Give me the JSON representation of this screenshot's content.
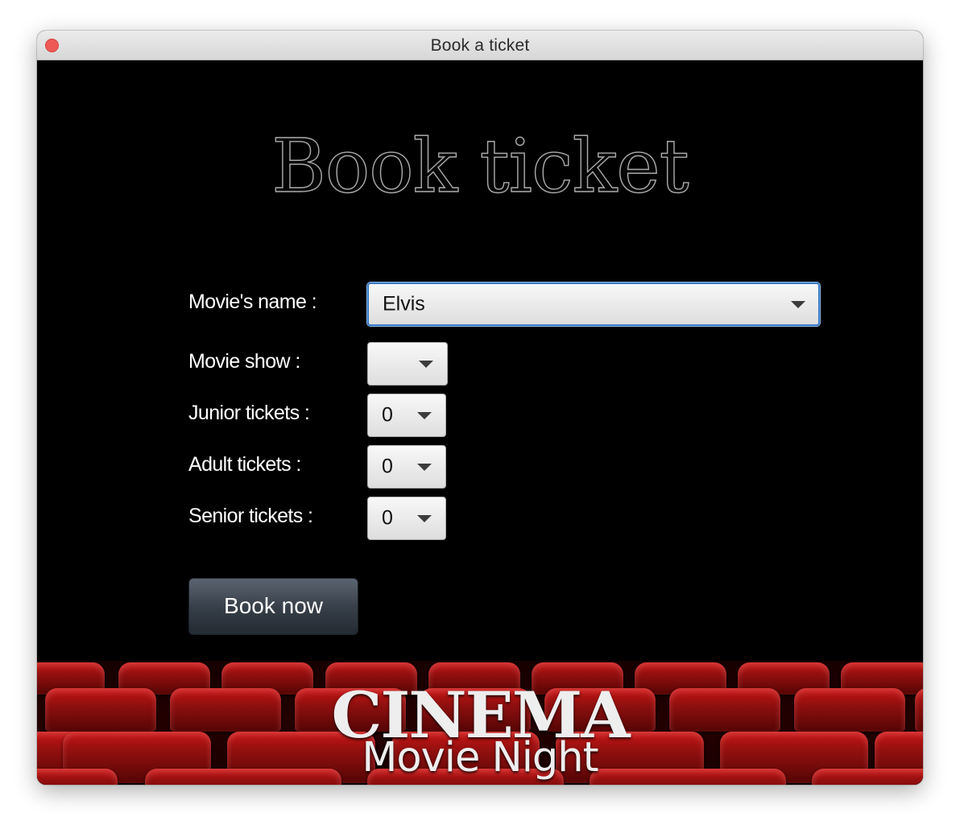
{
  "window": {
    "title": "Book a ticket"
  },
  "heading": "Book ticket",
  "form": {
    "movie_label": "Movie's name :",
    "movie_value": "Elvis",
    "show_label": "Movie show :",
    "show_value": "",
    "junior_label": "Junior tickets :",
    "junior_value": "0",
    "adult_label": "Adult tickets :",
    "adult_value": "0",
    "senior_label": "Senior tickets :",
    "senior_value": "0"
  },
  "book_button": "Book now",
  "banner": {
    "title": "CINEMA",
    "tagline": "Movie Night"
  },
  "colors": {
    "background": "#000000",
    "seat": "#a01010",
    "focus": "#3b7bc8",
    "close_button": "#ee5a55"
  },
  "icons": [
    "close-icon",
    "chevron-down-icon"
  ]
}
